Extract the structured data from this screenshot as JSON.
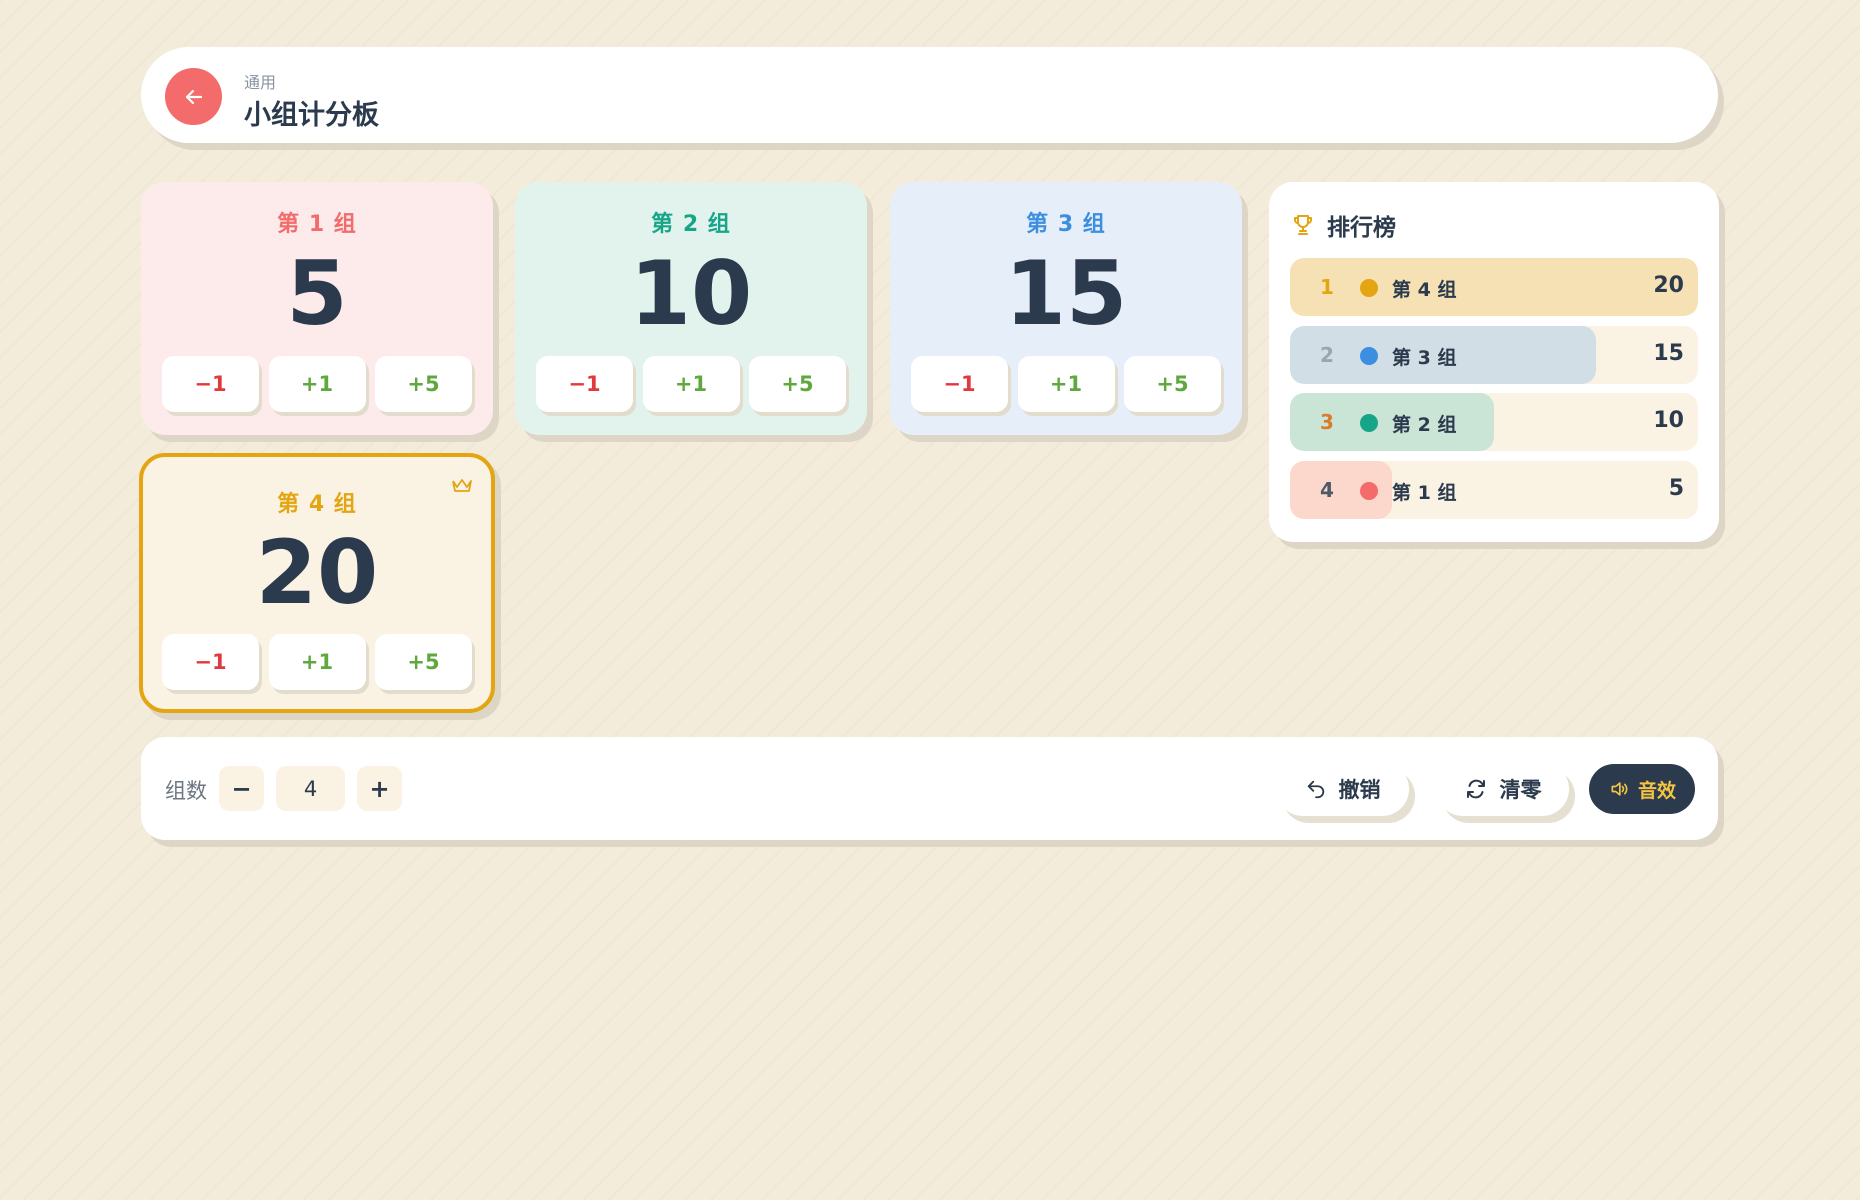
{
  "header": {
    "subtitle": "通用",
    "title": "小组计分板"
  },
  "cards": [
    {
      "name": "第 1 组",
      "score": "5",
      "minus": "−1",
      "plus1": "+1",
      "plus5": "+5",
      "color": "#f46b6b",
      "bg": "#fdeaea"
    },
    {
      "name": "第 2 组",
      "score": "10",
      "minus": "−1",
      "plus1": "+1",
      "plus5": "+5",
      "color": "#17a589",
      "bg": "#e2f3ee"
    },
    {
      "name": "第 3 组",
      "score": "15",
      "minus": "−1",
      "plus1": "+1",
      "plus5": "+5",
      "color": "#3b8ee0",
      "bg": "#e6eff9"
    },
    {
      "name": "第 4 组",
      "score": "20",
      "minus": "−1",
      "plus1": "+1",
      "plus5": "+5",
      "color": "#e3a511",
      "bg": "#faf3e3",
      "leader": true
    }
  ],
  "leaderboard": {
    "title": "排行榜",
    "rows": [
      {
        "rank": "1",
        "name": "第 4 组",
        "score": "20",
        "fraction": 1.0,
        "dot": "#e3a511",
        "fill": "#f5e1b3",
        "rank_color": "#e3a511"
      },
      {
        "rank": "2",
        "name": "第 3 组",
        "score": "15",
        "fraction": 0.75,
        "dot": "#3b8ee0",
        "fill": "#d2dee5",
        "rank_color": "#9aa5b0"
      },
      {
        "rank": "3",
        "name": "第 2 组",
        "score": "10",
        "fraction": 0.5,
        "dot": "#17a589",
        "fill": "#cae5d5",
        "rank_color": "#d97c2b"
      },
      {
        "rank": "4",
        "name": "第 1 组",
        "score": "5",
        "fraction": 0.25,
        "dot": "#f46b6b",
        "fill": "#fbd8cb",
        "rank_color": "#4f5a66"
      }
    ]
  },
  "toolbar": {
    "count_label": "组数",
    "count_minus": "−",
    "count_value": "4",
    "count_plus": "+",
    "undo_label": "撤销",
    "reset_label": "清零",
    "sound_label": "音效"
  },
  "icons": {
    "back": "arrow-left-icon",
    "crown": "crown-icon",
    "trophy": "trophy-icon",
    "undo": "undo-icon",
    "reset": "refresh-icon",
    "sound": "speaker-icon"
  }
}
